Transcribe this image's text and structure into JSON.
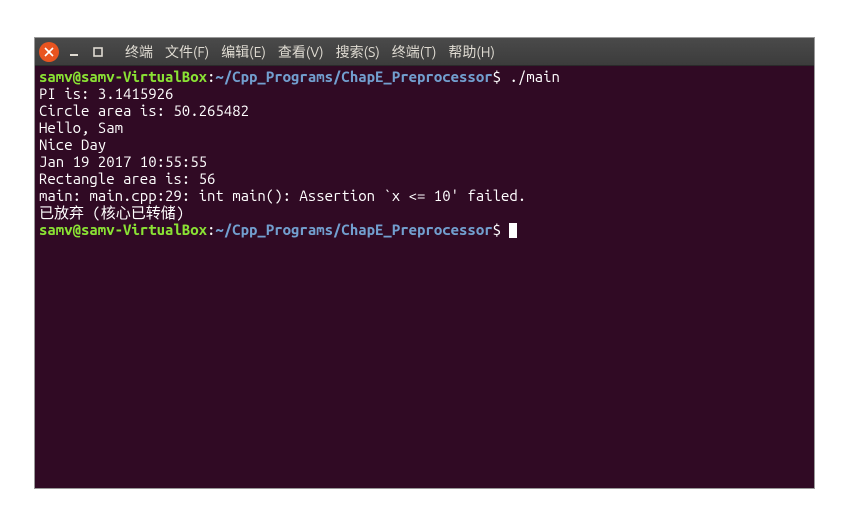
{
  "menu": {
    "items": [
      {
        "label": "终端"
      },
      {
        "label": "文件(F)"
      },
      {
        "label": "编辑(E)"
      },
      {
        "label": "查看(V)"
      },
      {
        "label": "搜索(S)"
      },
      {
        "label": "终端(T)"
      },
      {
        "label": "帮助(H)"
      }
    ]
  },
  "terminal": {
    "prompt1": {
      "userhost": "samv@samv-VirtualBox",
      "colon": ":",
      "path": "~/Cpp_Programs/ChapE_Preprocessor",
      "dollar": "$ ",
      "command": "./main"
    },
    "output": [
      "PI is: 3.1415926",
      "Circle area is: 50.265482",
      "Hello, Sam",
      "Nice Day",
      "Jan 19 2017 10:55:55",
      "Rectangle area is: 56",
      "main: main.cpp:29: int main(): Assertion `x <= 10' failed.",
      "已放弃 (核心已转储)"
    ],
    "prompt2": {
      "userhost": "samv@samv-VirtualBox",
      "colon": ":",
      "path": "~/Cpp_Programs/ChapE_Preprocessor",
      "dollar": "$ "
    }
  }
}
